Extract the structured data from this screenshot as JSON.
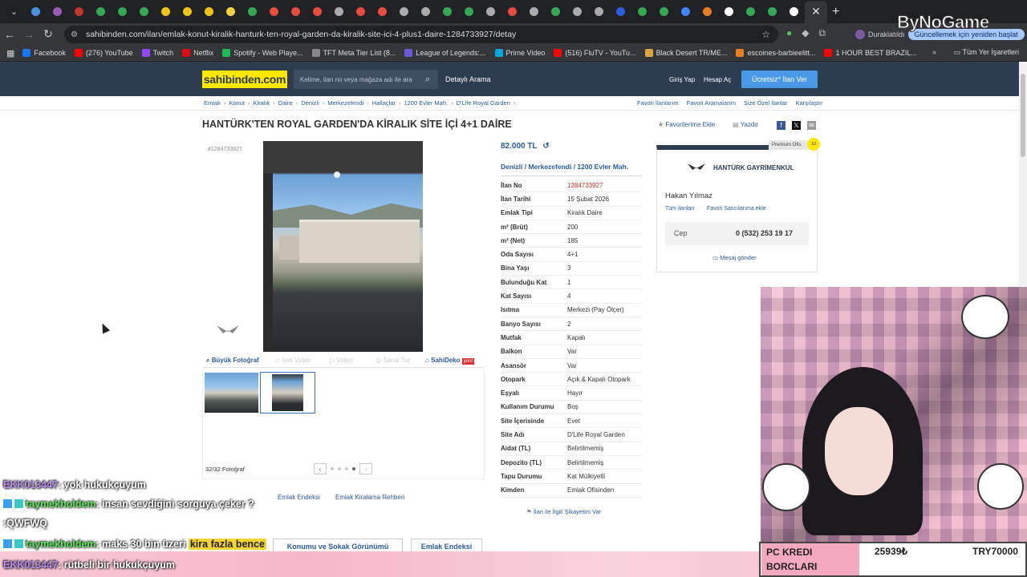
{
  "browser": {
    "url": "sahibinden.com/ilan/emlak-konut-kiralik-hanturk-ten-royal-garden-da-kiralik-site-ici-4-plus1-daire-1284733927/detay",
    "paused_label": "Duraklatıldı",
    "restart_label": "Güncellemek için yeniden başlat",
    "bookmarks": [
      "Facebook",
      "(276) YouTube",
      "Twitch",
      "Netflix",
      "Spotify - Web Playe...",
      "TFT Meta Tier List (8...",
      "League of Legends:...",
      "Prime Video",
      "(516) FluTV - YouTu...",
      "Black Desert TR/ME...",
      "escoines-barbieelitt...",
      "1 HOUR BEST BRAZIL..."
    ],
    "all_bookmarks": "Tüm Yer İşaretleri",
    "tab_colors": [
      "#4a90e2",
      "#9b59b6",
      "#c0392b",
      "#34a853",
      "#34a853",
      "#34a853",
      "#f1c40f",
      "#f1c40f",
      "#f1c40f",
      "#f4d03f",
      "#34a853",
      "#e74c3c",
      "#e74c3c",
      "#e74c3c",
      "#aaaaaa",
      "#e74c3c",
      "#e74c3c",
      "#aaaaaa",
      "#aaaaaa",
      "#34a853",
      "#34a853",
      "#aaaaaa",
      "#e74c3c",
      "#aaaaaa",
      "#34a853",
      "#aaaaaa",
      "#aaaaaa",
      "#2d5be3",
      "#34a853",
      "#34a853",
      "#4285f4",
      "#e67e22",
      "#ffffff",
      "#34a853",
      "#34a853",
      "#ffffff"
    ]
  },
  "site": {
    "logo": "sahibinden.com",
    "search_placeholder": "Kelime, ilan no veya mağaza adı ile ara",
    "advanced_search": "Detaylı Arama",
    "login": "Giriş Yap",
    "register": "Hesap Aç",
    "post_ad": "Ücretsiz* İlan Ver",
    "accent": "#ffe800",
    "header_color": "#2d3c51"
  },
  "breadcrumb": [
    "Emlak",
    "Konut",
    "Kiralık",
    "Daire",
    "Denizli",
    "Merkezefendi",
    "Hallaçlar",
    "1200 Evler Mah.",
    "D'Life Royal Garden"
  ],
  "right_links": [
    "Favori İlanlarım",
    "Favori Aramalarım",
    "Size Özel İlanlar",
    "Karşılaştır"
  ],
  "listing": {
    "title": "HANTÜRK'TEN ROYAL GARDEN'DA KİRALIK SİTE İÇİ 4+1 DAİRE",
    "fav_add": "Favorilerime Ekle",
    "print": "Yazdır",
    "number_tag": "#1284733927",
    "price": "82.000 TL",
    "location": "Denizli  /  Merkezefendi  /  1200 Evler Mah.",
    "gallery_tabs": [
      "Büyük Fotoğraf",
      "İlan Video",
      "Video",
      "Sanal Tur",
      "SahiDeko"
    ],
    "new_badge": "yeni",
    "photo_count": "32/32 Fotoğraf",
    "complaint": "İlan ile İlgili Şikayetim Var",
    "links": [
      "Emlak Endeksi",
      "Emlak Kiralama Rehberi"
    ],
    "bottom_buttons": [
      "Konumu ve Sokak Görünümü",
      "Emlak Endeksi"
    ],
    "details": [
      {
        "k": "İlan No",
        "v": "1284733927"
      },
      {
        "k": "İlan Tarihi",
        "v": "15 Şubat 2026"
      },
      {
        "k": "Emlak Tipi",
        "v": "Kiralık Daire"
      },
      {
        "k": "m² (Brüt)",
        "v": "200"
      },
      {
        "k": "m² (Net)",
        "v": "185"
      },
      {
        "k": "Oda Sayısı",
        "v": "4+1"
      },
      {
        "k": "Bina Yaşı",
        "v": "3"
      },
      {
        "k": "Bulunduğu Kat",
        "v": "1"
      },
      {
        "k": "Kat Sayısı",
        "v": "4"
      },
      {
        "k": "Isıtma",
        "v": "Merkezi (Pay Ölçer)"
      },
      {
        "k": "Banyo Sayısı",
        "v": "2"
      },
      {
        "k": "Mutfak",
        "v": "Kapalı"
      },
      {
        "k": "Balkon",
        "v": "Var"
      },
      {
        "k": "Asansör",
        "v": "Var"
      },
      {
        "k": "Otopark",
        "v": "Açık & Kapalı Otopark"
      },
      {
        "k": "Eşyalı",
        "v": "Hayır"
      },
      {
        "k": "Kullanım Durumu",
        "v": "Boş"
      },
      {
        "k": "Site İçerisinde",
        "v": "Evet"
      },
      {
        "k": "Site Adı",
        "v": "D'Life Royal Garden"
      },
      {
        "k": "Aidat (TL)",
        "v": "Belirtilmemiş"
      },
      {
        "k": "Depozito (TL)",
        "v": "Belirtilmemiş"
      },
      {
        "k": "Tapu Durumu",
        "v": "Kat Mülkiyetli"
      },
      {
        "k": "Kimden",
        "v": "Emlak Ofisinden"
      }
    ]
  },
  "agent": {
    "premium": "Premium Ofis",
    "premium_badge": "10",
    "name": "HANTÜRK GAYRİMENKUL",
    "person": "Hakan Yılmaz",
    "all_ads": "Tüm ilanları",
    "fav_seller": "Favori Satıcılarıma ekle",
    "phone_label": "Cep",
    "phone": "0 (532) 253 19 17",
    "message": "Mesaj gönder"
  },
  "overlay": {
    "watermark": "ByNoGame",
    "chat": [
      {
        "user": "EKK013447",
        "text": ": yok hukukçuyum"
      },
      {
        "user": "taymekholdem",
        "text": ": insan sevdiğini sorguya çeker ?"
      },
      {
        "user": "",
        "text": ":QWFWQ"
      },
      {
        "user": "taymekholdem",
        "text": ": maks 30 bin üzeri ",
        "hl": "kira fazla bence"
      },
      {
        "user": "EKK013447",
        "text": ": rütbeli bir hukukçuyum"
      }
    ],
    "debt_label": "PC KREDI BORCLARI",
    "debt_val1": "25939₺",
    "debt_val2": "TRY70000"
  }
}
